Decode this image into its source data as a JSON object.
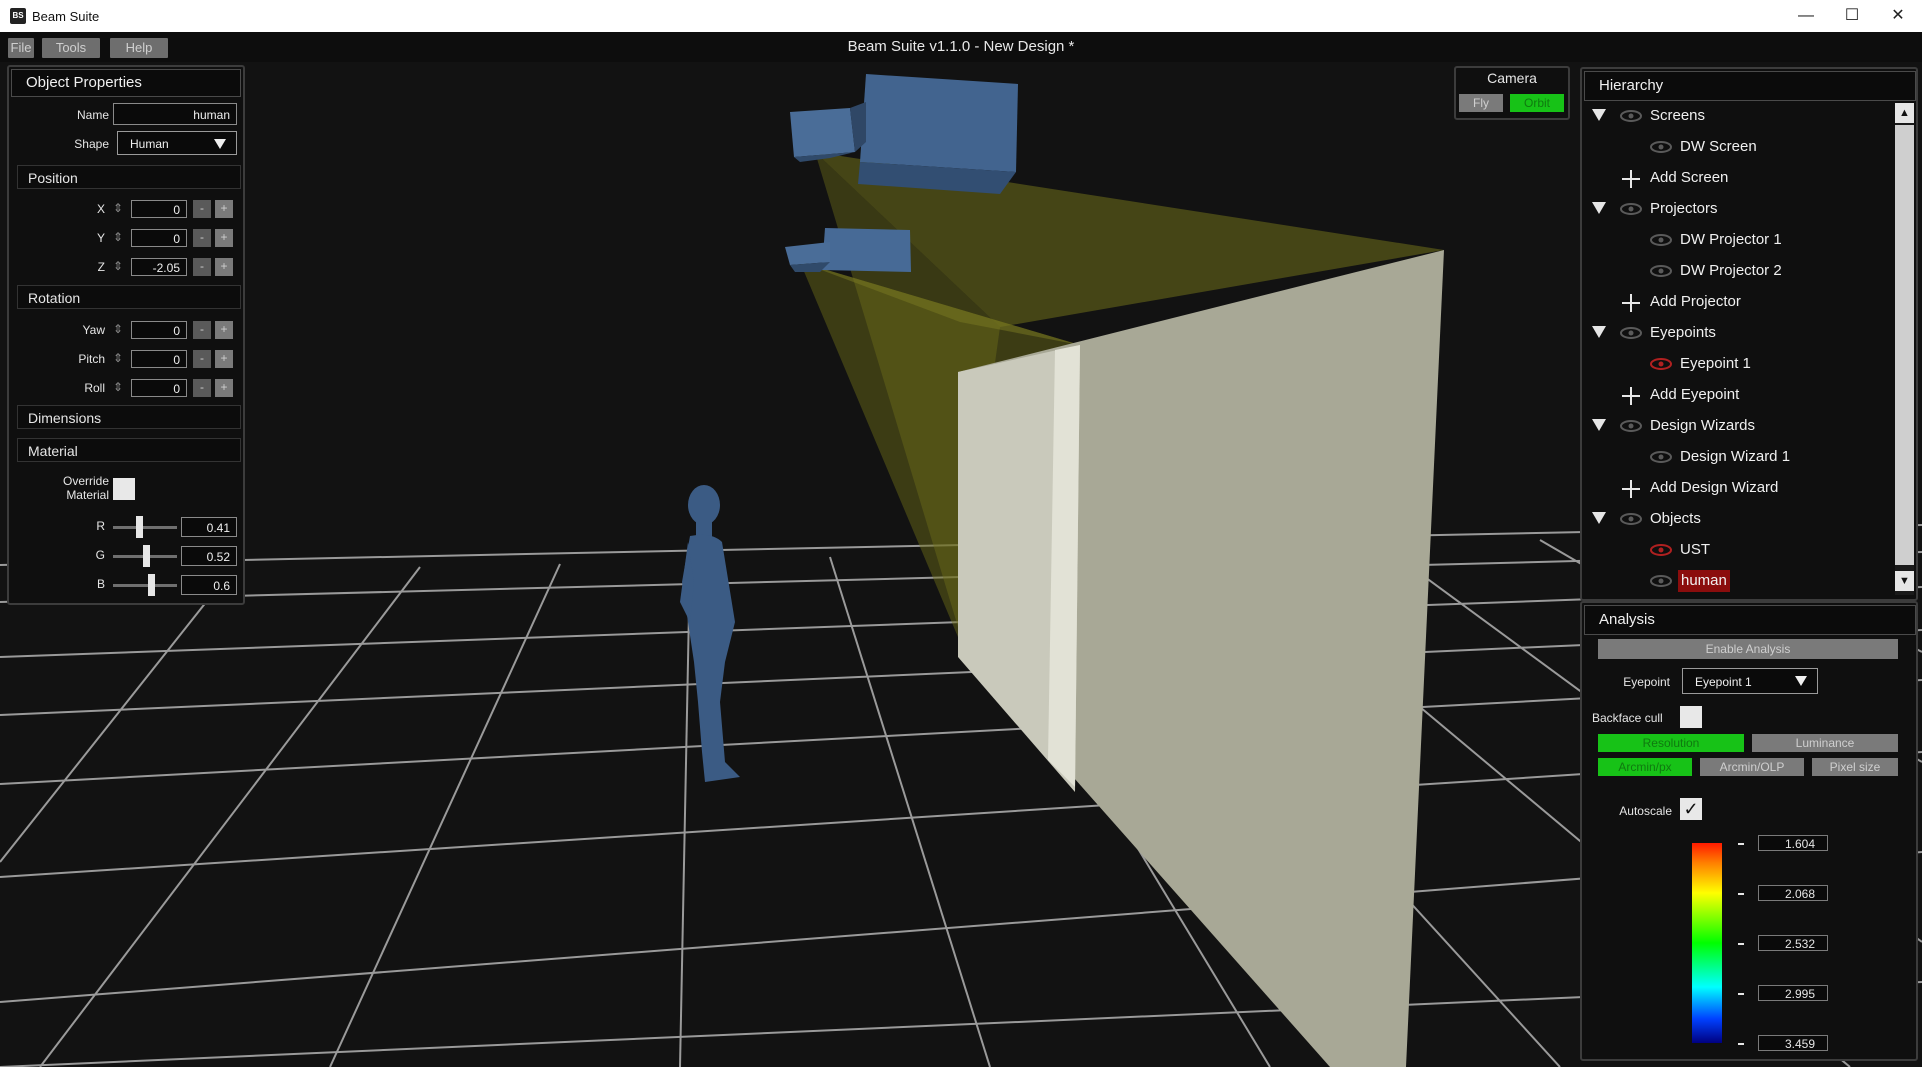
{
  "window": {
    "app_icon_text": "BS",
    "app_title": "Beam Suite",
    "minimize_glyph": "—",
    "maximize_glyph": "☐",
    "close_glyph": "✕"
  },
  "menu": {
    "file": "File",
    "tools": "Tools",
    "help": "Help",
    "doc_title": "Beam Suite v1.1.0 -  New Design *"
  },
  "object_properties": {
    "header": "Object Properties",
    "name_label": "Name",
    "name_value": "human",
    "shape_label": "Shape",
    "shape_value": "Human",
    "position_header": "Position",
    "rotation_header": "Rotation",
    "dimensions_header": "Dimensions",
    "material_header": "Material",
    "position": [
      {
        "label": "X",
        "value": "0"
      },
      {
        "label": "Y",
        "value": "0"
      },
      {
        "label": "Z",
        "value": "-2.05"
      }
    ],
    "rotation": [
      {
        "label": "Yaw",
        "value": "0"
      },
      {
        "label": "Pitch",
        "value": "0"
      },
      {
        "label": "Roll",
        "value": "0"
      }
    ],
    "override_material_label_1": "Override",
    "override_material_label_2": "Material",
    "minus": "-",
    "plus": "+",
    "updown_glyph": "⇕",
    "rgb": [
      {
        "label": "R",
        "value": "0.41",
        "fraction": 0.41
      },
      {
        "label": "G",
        "value": "0.52",
        "fraction": 0.52
      },
      {
        "label": "B",
        "value": "0.6",
        "fraction": 0.6
      }
    ]
  },
  "camera": {
    "header": "Camera",
    "fly": "Fly",
    "orbit": "Orbit",
    "active": "orbit"
  },
  "hierarchy": {
    "header": "Hierarchy",
    "scroll_up": "▲",
    "scroll_down": "▼",
    "screens": "Screens",
    "dw_screen": "DW Screen",
    "add_screen": "Add Screen",
    "projectors": "Projectors",
    "dw_projector_1": "DW Projector 1",
    "dw_projector_2": "DW Projector 2",
    "add_projector": "Add Projector",
    "eyepoints": "Eyepoints",
    "eyepoint_1": "Eyepoint 1",
    "add_eyepoint": "Add Eyepoint",
    "design_wizards": "Design Wizards",
    "design_wizard_1": "Design Wizard 1",
    "add_design_wizard": "Add Design Wizard",
    "objects": "Objects",
    "ust": "UST",
    "human": "human"
  },
  "analysis": {
    "header": "Analysis",
    "enable": "Enable Analysis",
    "eyepoint_label": "Eyepoint",
    "eyepoint_value": "Eyepoint 1",
    "backface_label": "Backface cull",
    "resolution": "Resolution",
    "luminance": "Luminance",
    "arcmin_px": "Arcmin/px",
    "arcmin_olp": "Arcmin/OLP",
    "pixel_size": "Pixel size",
    "autoscale_label": "Autoscale",
    "check_glyph": "✓",
    "scale": [
      "1.604",
      "2.068",
      "2.532",
      "2.995",
      "3.459"
    ]
  },
  "colors": {
    "accent_green": "#17c217",
    "selected_red": "#8b0d0d",
    "human_blue": "#3b5b84",
    "screen_surface": "#b9b9a6",
    "beam_yellow": "#7a7a20"
  }
}
